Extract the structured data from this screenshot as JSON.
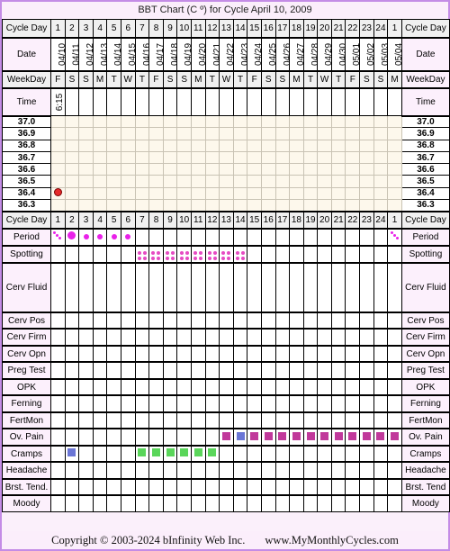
{
  "title": "BBT Chart (C º) for Cycle April 10, 2009",
  "labels": {
    "cycle_day": "Cycle Day",
    "date": "Date",
    "weekday": "WeekDay",
    "time": "Time",
    "period": "Period",
    "spotting": "Spotting",
    "cerv_fluid": "Cerv Fluid",
    "cerv_pos": "Cerv Pos",
    "cerv_firm": "Cerv Firm",
    "cerv_opn": "Cerv Opn",
    "preg_test": "Preg Test",
    "opk": "OPK",
    "ferning": "Ferning",
    "fertmon": "FertMon",
    "ov_pain": "Ov. Pain",
    "cramps": "Cramps",
    "headache": "Headache",
    "brst_tend_left": "Brst. Tend.",
    "brst_tend_right": "Brst. Tend",
    "moody": "Moody"
  },
  "days": [
    "1",
    "2",
    "3",
    "4",
    "5",
    "6",
    "7",
    "8",
    "9",
    "10",
    "11",
    "12",
    "13",
    "14",
    "15",
    "16",
    "17",
    "18",
    "19",
    "20",
    "21",
    "22",
    "23",
    "24",
    "1"
  ],
  "dates": [
    "04/10",
    "04/11",
    "04/12",
    "04/13",
    "04/14",
    "04/15",
    "04/16",
    "04/17",
    "04/18",
    "04/19",
    "04/20",
    "04/21",
    "04/22",
    "04/23",
    "04/24",
    "04/25",
    "04/26",
    "04/27",
    "04/28",
    "04/29",
    "04/30",
    "05/01",
    "05/02",
    "05/03",
    "05/04"
  ],
  "weekdays": [
    "F",
    "S",
    "S",
    "M",
    "T",
    "W",
    "T",
    "F",
    "S",
    "S",
    "M",
    "T",
    "W",
    "T",
    "F",
    "S",
    "S",
    "M",
    "T",
    "W",
    "T",
    "F",
    "S",
    "S",
    "M"
  ],
  "times": [
    "6:15",
    "",
    "",
    "",
    "",
    "",
    "",
    "",
    "",
    "",
    "",
    "",
    "",
    "",
    "",
    "",
    "",
    "",
    "",
    "",
    "",
    "",
    "",
    "",
    ""
  ],
  "temp_scale": [
    "37.0",
    "36.9",
    "36.8",
    "36.7",
    "36.6",
    "36.5",
    "36.4",
    "36.3"
  ],
  "temperatures": [
    36.4,
    null,
    null,
    null,
    null,
    null,
    null,
    null,
    null,
    null,
    null,
    null,
    null,
    null,
    null,
    null,
    null,
    null,
    null,
    null,
    null,
    null,
    null,
    null,
    null
  ],
  "period": [
    "spotting",
    "heavy",
    "medium",
    "medium",
    "medium",
    "medium",
    "",
    "",
    "",
    "",
    "",
    "",
    "",
    "",
    "",
    "",
    "",
    "",
    "",
    "",
    "",
    "",
    "",
    "",
    "spotting"
  ],
  "spotting": [
    "",
    "",
    "",
    "",
    "",
    "",
    true,
    true,
    true,
    true,
    true,
    true,
    true,
    true,
    "",
    "",
    "",
    "",
    "",
    "",
    "",
    "",
    "",
    "",
    ""
  ],
  "ov_pain": [
    "",
    "",
    "",
    "",
    "",
    "",
    "",
    "",
    "",
    "",
    "",
    "",
    "magenta",
    "blue",
    "magenta",
    "magenta",
    "magenta",
    "magenta",
    "magenta",
    "magenta",
    "magenta",
    "magenta",
    "magenta",
    "magenta",
    "magenta"
  ],
  "cramps": [
    "",
    "blue",
    "",
    "",
    "",
    "",
    "green",
    "green",
    "green",
    "green",
    "green",
    "green",
    "",
    "",
    "",
    "",
    "",
    "",
    "",
    "",
    "",
    "",
    "",
    "",
    ""
  ],
  "colors": {
    "temp_dot": "#e52b2b",
    "period": "#e922e9",
    "spotting": "#e64bc3",
    "magenta": "#c1399b",
    "blue": "#6b76d6",
    "green": "#5ad65a",
    "label_bg": "#fcf0fc",
    "chart_bg": "#fdf8ec",
    "border_accent": "#c48ce6"
  },
  "footer": {
    "copyright": "Copyright © 2003-2024 bInfinity Web Inc.",
    "site": "www.MyMonthlyCycles.com"
  }
}
